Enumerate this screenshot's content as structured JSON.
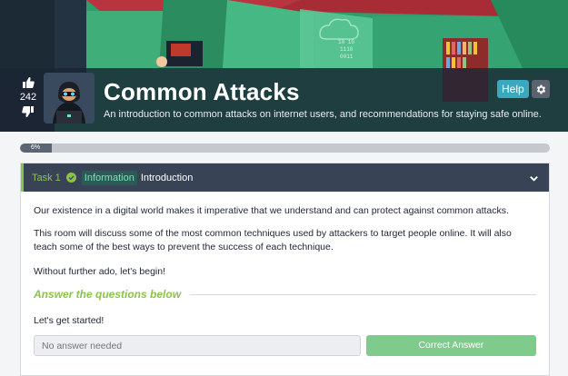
{
  "room": {
    "title": "Common Attacks",
    "description": "An introduction to common attacks on internet users, and recommendations for staying safe online.",
    "votes": "242",
    "help_label": "Help",
    "icons": {
      "upvote": "thumbs-up-icon",
      "downvote": "thumbs-down-icon",
      "settings": "gear-icon"
    }
  },
  "progress": {
    "label": "6%",
    "value": 6
  },
  "task": {
    "number": "Task 1",
    "badge": "Information",
    "title": "Introduction",
    "paragraphs": [
      "Our existence in a digital world makes it imperative that we understand and can protect against common attacks.",
      "This room will discuss some of the most common techniques used by attackers to target people online. It will also teach some of the best ways to prevent the success of each technique.",
      "Without further ado, let's begin!"
    ],
    "answer_heading": "Answer the questions below",
    "question": "Let's get started!",
    "answer_placeholder": "No answer needed",
    "submit_label": "Correct Answer"
  },
  "banner_text": {
    "binary_lines": [
      "10 10",
      "1110",
      "0011"
    ]
  },
  "colors": {
    "accent_green": "#8bc34a",
    "header_dark": "#384356",
    "help_blue": "#3aa8bf",
    "correct_green": "#7fcb8c"
  }
}
